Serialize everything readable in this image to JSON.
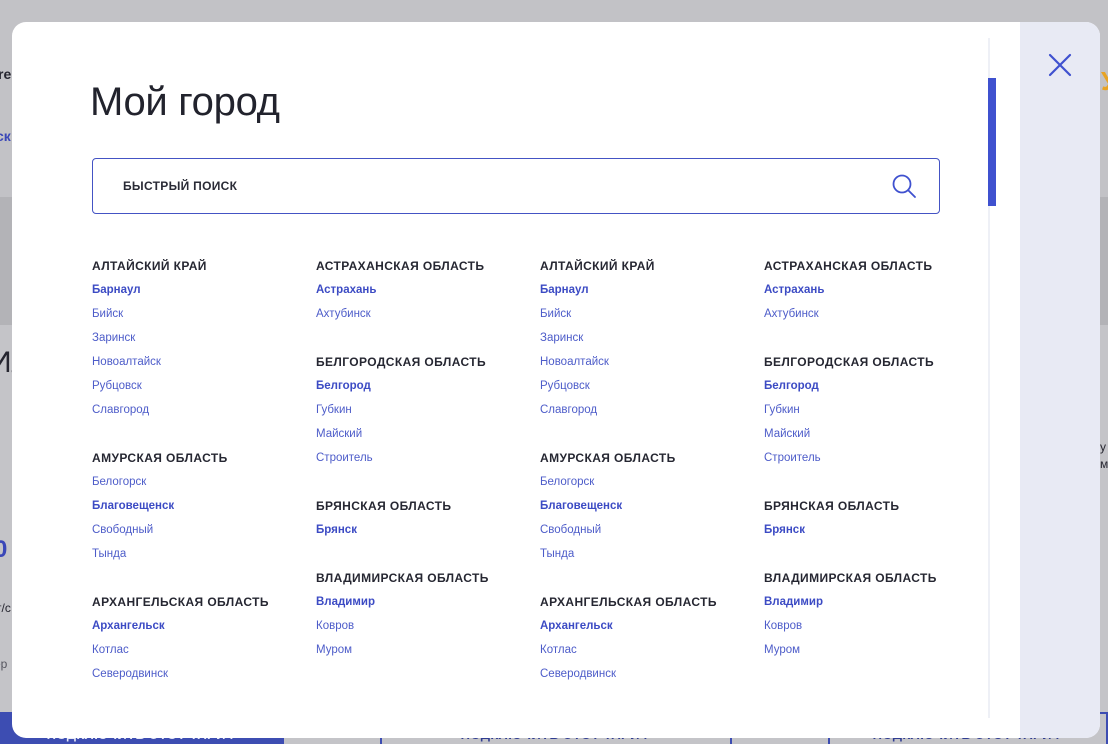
{
  "background": {
    "fragments": [
      {
        "text": "re",
        "style": "dark"
      },
      {
        "text": "ск",
        "style": "blue"
      },
      {
        "text": "Ил",
        "style": "dark"
      },
      {
        "text": "0",
        "style": "blue"
      },
      {
        "text": "т/с",
        "style": "dark"
      },
      {
        "text": "ер",
        "style": "dark"
      },
      {
        "text": "У",
        "style": "dark"
      },
      {
        "text": "у",
        "style": "dark"
      },
      {
        "text": "м",
        "style": "dark"
      }
    ],
    "tariff_buttons": [
      {
        "label": "ПОДКЛЮЧИТЬ ЭТОТ ТАРИФ",
        "style": "filled"
      },
      {
        "label": "ПОДКЛЮЧИТЬ ЭТОТ ТАРИФ",
        "style": "outline"
      },
      {
        "label": "ПОДКЛЮЧИТЬ ЭТОТ ТАРИФ",
        "style": "outline"
      }
    ]
  },
  "modal": {
    "title": "Мой город",
    "search": {
      "placeholder": "БЫСТРЫЙ ПОИСК",
      "value": ""
    },
    "close_icon": "close-icon",
    "search_icon": "search-icon",
    "colors": {
      "accent": "#3f51cf",
      "link": "#4d5cc9",
      "heading": "#262732",
      "side_panel": "#e8eaf4"
    },
    "columns": [
      {
        "regions": [
          {
            "name": "АЛТАЙСКИЙ КРАЙ",
            "cities": [
              {
                "name": "Барнаул",
                "main": true
              },
              {
                "name": "Бийск",
                "main": false
              },
              {
                "name": "Заринск",
                "main": false
              },
              {
                "name": "Новоалтайск",
                "main": false
              },
              {
                "name": "Рубцовск",
                "main": false
              },
              {
                "name": "Славгород",
                "main": false
              }
            ]
          },
          {
            "name": "АМУРСКАЯ ОБЛАСТЬ",
            "cities": [
              {
                "name": "Белогорск",
                "main": false
              },
              {
                "name": "Благовещенск",
                "main": true
              },
              {
                "name": "Свободный",
                "main": false
              },
              {
                "name": "Тында",
                "main": false
              }
            ]
          },
          {
            "name": "АРХАНГЕЛЬСКАЯ ОБЛАСТЬ",
            "cities": [
              {
                "name": "Архангельск",
                "main": true
              },
              {
                "name": "Котлас",
                "main": false
              },
              {
                "name": "Северодвинск",
                "main": false
              }
            ]
          }
        ]
      },
      {
        "regions": [
          {
            "name": "АСТРАХАНСКАЯ ОБЛАСТЬ",
            "cities": [
              {
                "name": "Астрахань",
                "main": true
              },
              {
                "name": "Ахтубинск",
                "main": false
              }
            ]
          },
          {
            "name": "БЕЛГОРОДСКАЯ ОБЛАСТЬ",
            "cities": [
              {
                "name": "Белгород",
                "main": true
              },
              {
                "name": "Губкин",
                "main": false
              },
              {
                "name": "Майский",
                "main": false
              },
              {
                "name": "Строитель",
                "main": false
              }
            ]
          },
          {
            "name": "БРЯНСКАЯ ОБЛАСТЬ",
            "cities": [
              {
                "name": "Брянск",
                "main": true
              }
            ]
          },
          {
            "name": "ВЛАДИМИРСКАЯ ОБЛАСТЬ",
            "cities": [
              {
                "name": "Владимир",
                "main": true
              },
              {
                "name": "Ковров",
                "main": false
              },
              {
                "name": "Муром",
                "main": false
              }
            ]
          }
        ]
      },
      {
        "regions": [
          {
            "name": "АЛТАЙСКИЙ КРАЙ",
            "cities": [
              {
                "name": "Барнаул",
                "main": true
              },
              {
                "name": "Бийск",
                "main": false
              },
              {
                "name": "Заринск",
                "main": false
              },
              {
                "name": "Новоалтайск",
                "main": false
              },
              {
                "name": "Рубцовск",
                "main": false
              },
              {
                "name": "Славгород",
                "main": false
              }
            ]
          },
          {
            "name": "АМУРСКАЯ ОБЛАСТЬ",
            "cities": [
              {
                "name": "Белогорск",
                "main": false
              },
              {
                "name": "Благовещенск",
                "main": true
              },
              {
                "name": "Свободный",
                "main": false
              },
              {
                "name": "Тында",
                "main": false
              }
            ]
          },
          {
            "name": "АРХАНГЕЛЬСКАЯ ОБЛАСТЬ",
            "cities": [
              {
                "name": "Архангельск",
                "main": true
              },
              {
                "name": "Котлас",
                "main": false
              },
              {
                "name": "Северодвинск",
                "main": false
              }
            ]
          }
        ]
      },
      {
        "regions": [
          {
            "name": "АСТРАХАНСКАЯ ОБЛАСТЬ",
            "cities": [
              {
                "name": "Астрахань",
                "main": true
              },
              {
                "name": "Ахтубинск",
                "main": false
              }
            ]
          },
          {
            "name": "БЕЛГОРОДСКАЯ ОБЛАСТЬ",
            "cities": [
              {
                "name": "Белгород",
                "main": true
              },
              {
                "name": "Губкин",
                "main": false
              },
              {
                "name": "Майский",
                "main": false
              },
              {
                "name": "Строитель",
                "main": false
              }
            ]
          },
          {
            "name": "БРЯНСКАЯ ОБЛАСТЬ",
            "cities": [
              {
                "name": "Брянск",
                "main": true
              }
            ]
          },
          {
            "name": "ВЛАДИМИРСКАЯ ОБЛАСТЬ",
            "cities": [
              {
                "name": "Владимир",
                "main": true
              },
              {
                "name": "Ковров",
                "main": false
              },
              {
                "name": "Муром",
                "main": false
              }
            ]
          }
        ]
      }
    ]
  }
}
